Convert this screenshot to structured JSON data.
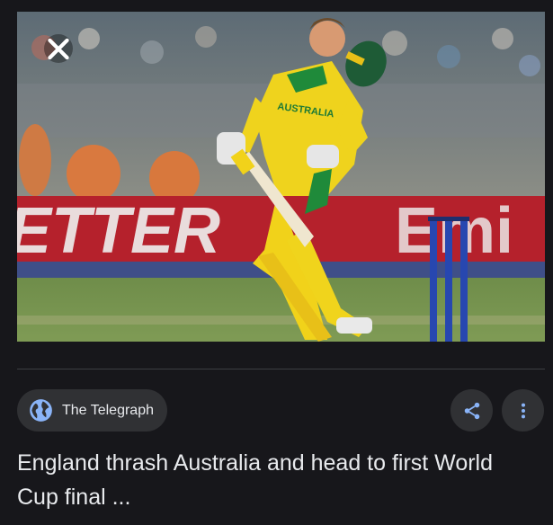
{
  "image": {
    "banner_text_left": "ETTER",
    "banner_text_right": "Emi",
    "shirt_text": "AUSTRALIA"
  },
  "icons": {
    "close": "close-icon",
    "globe": "globe-icon",
    "share": "share-icon",
    "more": "more-vert-icon"
  },
  "source": {
    "name": "The Telegraph"
  },
  "headline": "England thrash Australia and head to first World Cup final ...",
  "colors": {
    "background": "#17171b",
    "chip": "#303134",
    "accent_blue": "#8ab4f8",
    "text": "#e8eaed"
  }
}
